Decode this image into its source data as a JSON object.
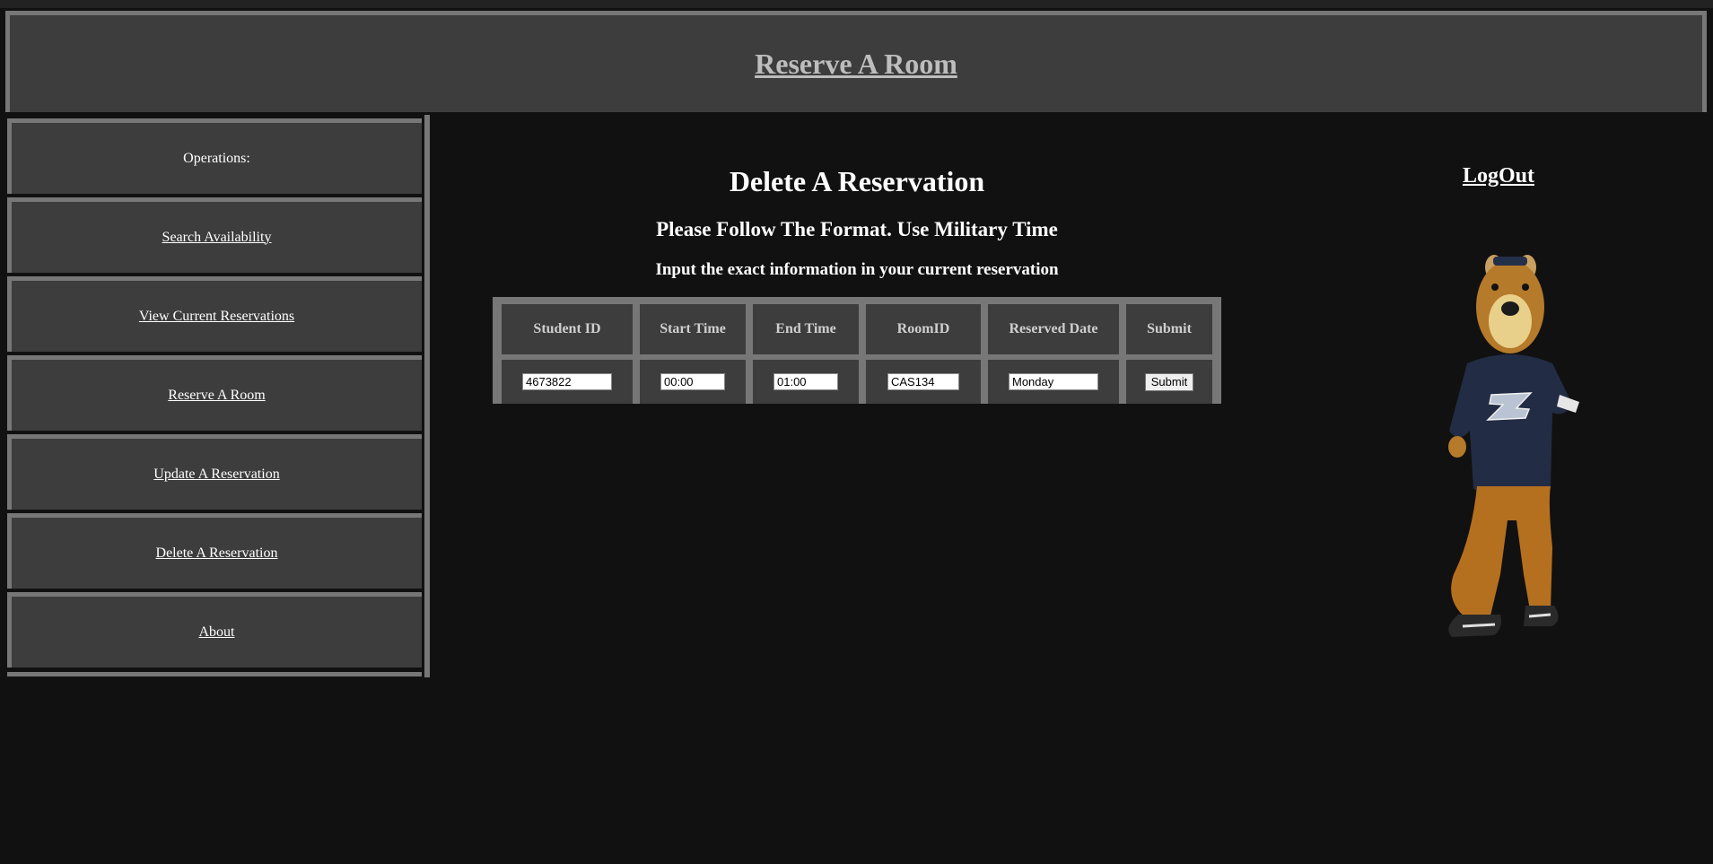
{
  "header": {
    "title": "Reserve A Room"
  },
  "sidebar": {
    "heading": "Operations:",
    "items": [
      {
        "label": "Search Availability"
      },
      {
        "label": "View Current Reservations"
      },
      {
        "label": "Reserve A Room"
      },
      {
        "label": "Update A Reservation"
      },
      {
        "label": "Delete A Reservation"
      },
      {
        "label": "About"
      }
    ]
  },
  "main": {
    "title": "Delete A Reservation",
    "subtitle": "Please Follow The Format. Use Military Time",
    "instruction": "Input the exact information in your current reservation",
    "columns": [
      "Student ID",
      "Start Time",
      "End Time",
      "RoomID",
      "Reserved Date",
      "Submit"
    ],
    "form": {
      "student_id": "4673822",
      "start_time": "00:00",
      "end_time": "01:00",
      "room_id": "CAS134",
      "reserved_date": "Monday",
      "submit_label": "Submit"
    }
  },
  "logout": {
    "label": "LogOut"
  },
  "colors": {
    "background": "#111111",
    "panel": "#3d3d3d",
    "border": "#777777",
    "header_link": "#bdbdbd"
  },
  "icons": {
    "mascot": "mascot-image"
  }
}
